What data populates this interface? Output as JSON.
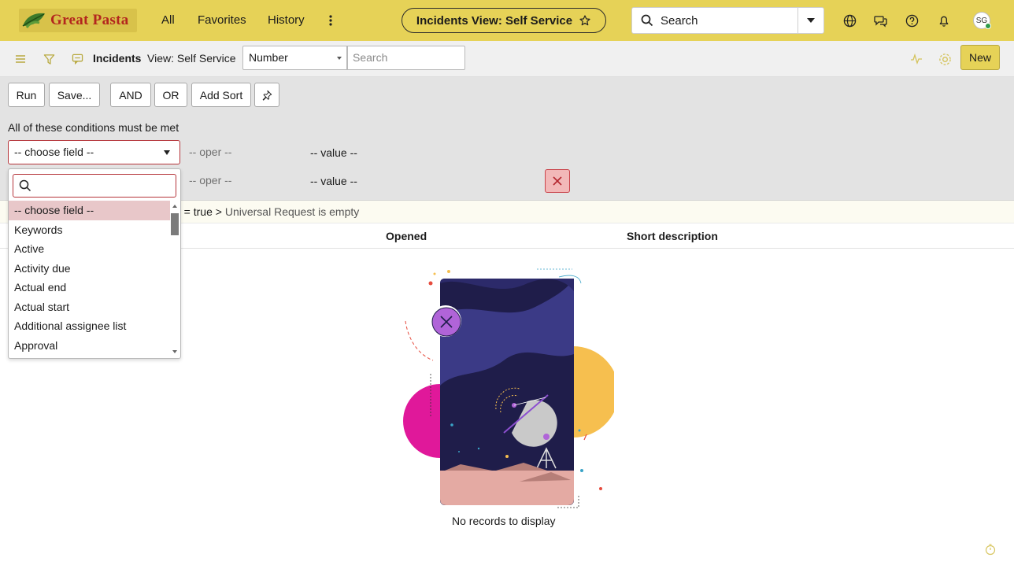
{
  "header": {
    "logo_text": "Great Pasta",
    "nav": [
      "All",
      "Favorites",
      "History"
    ],
    "context_pill": "Incidents View: Self Service",
    "search_placeholder": "Search",
    "avatar_initials": "SG",
    "accent_color": "#e6d257"
  },
  "list_header": {
    "title": "Incidents",
    "view_label": "View: Self Service",
    "field_select_value": "Number",
    "search_placeholder": "Search",
    "new_button": "New"
  },
  "filter": {
    "buttons": {
      "run": "Run",
      "save": "Save...",
      "and": "AND",
      "or": "OR",
      "add_sort": "Add Sort"
    },
    "condition_heading": "All of these conditions must be met",
    "rows": [
      {
        "field": "-- choose field --",
        "operator": "-- oper --",
        "value": "-- value --"
      },
      {
        "field": "-- choose field --",
        "operator": "-- oper --",
        "value": "-- value --"
      }
    ]
  },
  "breadcrumb": {
    "prefix": "e = true",
    "separator": ">",
    "last": "Universal Request is empty"
  },
  "table": {
    "columns": [
      "Opened",
      "Short description"
    ],
    "empty_message": "No records to display"
  },
  "field_dropdown": {
    "search_value": "",
    "options": [
      "-- choose field --",
      "Keywords",
      "Active",
      "Activity due",
      "Actual end",
      "Actual start",
      "Additional assignee list",
      "Approval"
    ],
    "selected_index": 0
  }
}
